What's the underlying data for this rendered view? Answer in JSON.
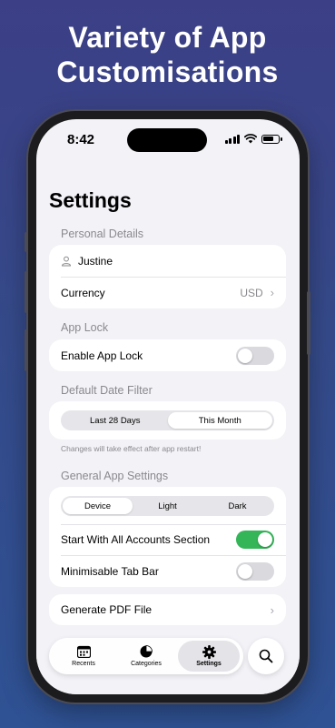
{
  "promo": {
    "title_line1": "Variety of App",
    "title_line2": "Customisations"
  },
  "status_bar": {
    "time": "8:42"
  },
  "settings": {
    "title": "Settings",
    "personal_details": {
      "header": "Personal Details",
      "name": "Justine",
      "currency_label": "Currency",
      "currency_value": "USD"
    },
    "app_lock": {
      "header": "App Lock",
      "enable_label": "Enable App Lock",
      "enabled": false
    },
    "date_filter": {
      "header": "Default Date Filter",
      "options": [
        "Last 28 Days",
        "This Month"
      ],
      "selected": "This Month",
      "note": "Changes will take effect after app restart!"
    },
    "general": {
      "header": "General App Settings",
      "theme_options": [
        "Device",
        "Light",
        "Dark"
      ],
      "selected_theme": "Device",
      "all_accounts_label": "Start With All Accounts Section",
      "all_accounts_on": true,
      "minimisable_label": "Minimisable Tab Bar",
      "minimisable_on": false
    },
    "generate_pdf_label": "Generate PDF File"
  },
  "tab_bar": {
    "tabs": [
      {
        "label": "Recents",
        "icon": "calendar-icon"
      },
      {
        "label": "Categories",
        "icon": "pie-chart-icon"
      },
      {
        "label": "Settings",
        "icon": "gear-icon",
        "active": true
      }
    ],
    "search_icon": "search-icon"
  },
  "colors": {
    "toggle_on": "#34b558",
    "background_top": "#3c3f86",
    "background_bottom": "#2f5294"
  }
}
